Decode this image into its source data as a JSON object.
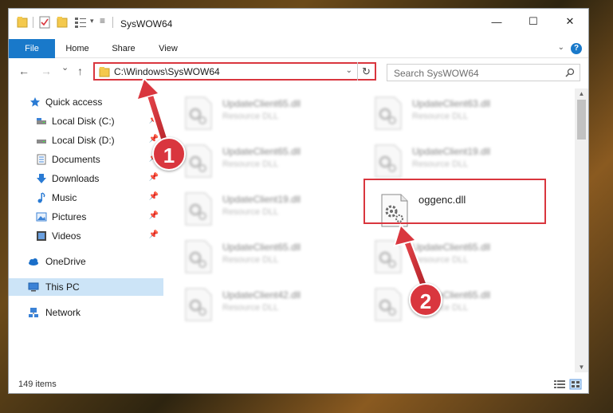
{
  "window": {
    "title": "SysWOW64",
    "controls": {
      "minimize": "—",
      "maximize": "☐",
      "close": "✕"
    }
  },
  "ribbon": {
    "tabs": [
      {
        "label": "File"
      },
      {
        "label": "Home"
      },
      {
        "label": "Share"
      },
      {
        "label": "View"
      }
    ],
    "help": "?"
  },
  "navigation": {
    "back": "←",
    "forward": "→",
    "recent": "⌄",
    "up": "↑",
    "address": "C:\\Windows\\SysWOW64",
    "search_placeholder": "Search SysWOW64"
  },
  "sidebar": {
    "items": [
      {
        "label": "Quick access",
        "icon": "star-icon"
      },
      {
        "label": "Local Disk (C:)",
        "icon": "drive-icon",
        "pinned": true
      },
      {
        "label": "Local Disk (D:)",
        "icon": "drive-icon",
        "pinned": true
      },
      {
        "label": "Documents",
        "icon": "documents-icon",
        "pinned": true
      },
      {
        "label": "Downloads",
        "icon": "downloads-icon",
        "pinned": true
      },
      {
        "label": "Music",
        "icon": "music-icon",
        "pinned": true
      },
      {
        "label": "Pictures",
        "icon": "pictures-icon",
        "pinned": true
      },
      {
        "label": "Videos",
        "icon": "videos-icon",
        "pinned": true
      },
      {
        "label": "OneDrive",
        "icon": "cloud-icon"
      },
      {
        "label": "This PC",
        "icon": "computer-icon",
        "selected": true
      },
      {
        "label": "Network",
        "icon": "network-icon"
      }
    ]
  },
  "files": [
    {
      "name": "UpdateClient65.dll",
      "type": "Resource DLL"
    },
    {
      "name": "UpdateClient63.dll",
      "type": "Resource DLL"
    },
    {
      "name": "UpdateClient65.dll",
      "type": "Resource DLL"
    },
    {
      "name": "UpdateClient19.dll",
      "type": "Resource DLL"
    },
    {
      "name": "UpdateClient19.dll",
      "type": "Resource DLL"
    },
    {
      "name": "oggenc.dll",
      "type": ""
    },
    {
      "name": "UpdateClient65.dll",
      "type": "Resource DLL"
    },
    {
      "name": "UpdateClient65.dll",
      "type": "Resource DLL"
    },
    {
      "name": "UpdateClient42.dll",
      "type": "Resource DLL"
    },
    {
      "name": "UpdateClient65.dll",
      "type": "Resource DLL"
    }
  ],
  "status": {
    "item_count": "149 items"
  },
  "annotations": {
    "callout_1": "1",
    "callout_2": "2"
  },
  "colors": {
    "accent": "#1979ca",
    "highlight": "#d9363e",
    "selected": "#cce4f7"
  }
}
